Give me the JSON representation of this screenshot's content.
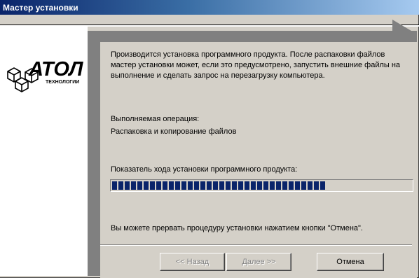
{
  "window": {
    "title": "Мастер установки"
  },
  "logo": {
    "brand": "АТОЛ",
    "tagline": "технологии"
  },
  "main": {
    "intro_line1": "Производится установка программного продукта. После распаковки файлов",
    "intro_line2": "мастер установки может, если это предусмотрено, запустить внешние файлы на",
    "intro_line3": "выполнение и сделать запрос на перезагрузку компьютера.",
    "operation_label": "Выполняемая операция:",
    "operation_value": "Распаковка и копирование файлов",
    "progress_label": "Показатель хода установки программного продукта:",
    "progress_fraction": 0.72,
    "cancel_hint": "Вы можете прервать процедуру установки нажатием кнопки \"Отмена\"."
  },
  "buttons": {
    "back": "<< Назад",
    "next": "Далее >>",
    "cancel": "Отмена"
  },
  "colors": {
    "progress_block": "#0a246a",
    "title_start": "#0a246a",
    "title_end": "#a6caf0"
  }
}
